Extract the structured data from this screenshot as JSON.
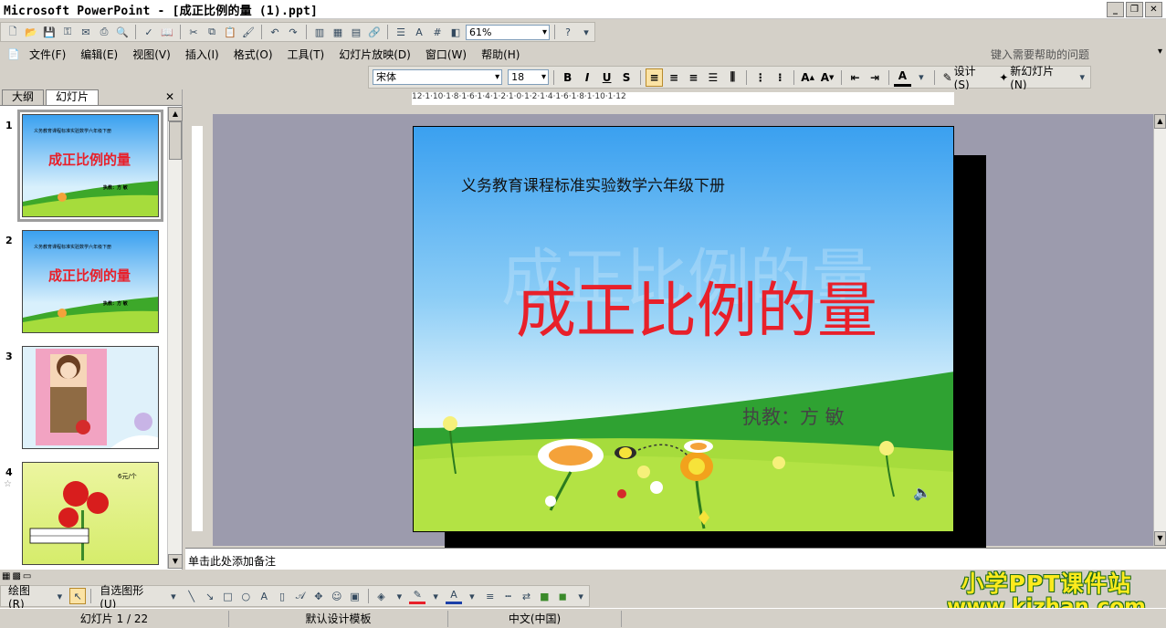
{
  "window": {
    "title": "Microsoft PowerPoint - [成正比例的量 (1).ppt]"
  },
  "toolbar": {
    "zoom": "61%"
  },
  "menu": {
    "items": [
      "文件(F)",
      "编辑(E)",
      "视图(V)",
      "插入(I)",
      "格式(O)",
      "工具(T)",
      "幻灯片放映(D)",
      "窗口(W)",
      "帮助(H)"
    ],
    "help_placeholder": "键入需要帮助的问题"
  },
  "format_toolbar": {
    "font": "宋体",
    "size": "18",
    "design_label": "设计(S)",
    "new_slide_label": "新幻灯片(N)"
  },
  "left_pane": {
    "tabs": [
      "大纲",
      "幻灯片"
    ],
    "slide_numbers": [
      "1",
      "2",
      "3",
      "4"
    ],
    "thumb_title": "成正比例的量",
    "thumb_small_title": "义务教育课程标准实验数学六年级下册",
    "thumb_author": "执教：方 敏",
    "thumb4_label": "6元/个"
  },
  "slide": {
    "subtitle": "义务教育课程标准实验数学六年级下册",
    "title": "成正比例的量",
    "author": "执教：方  敏"
  },
  "ruler": {
    "horizontal": "12·1·10·1·8·1·6·1·4·1·2·1·0·1·2·1·4·1·6·1·8·1·10·1·12"
  },
  "notes": {
    "placeholder": "单击此处添加备注"
  },
  "draw_toolbar": {
    "draw_label": "绘图(R)",
    "autoshapes_label": "自选图形(U)"
  },
  "status": {
    "slide_info": "幻灯片 1 / 22",
    "template": "默认设计模板",
    "language": "中文(中国)"
  },
  "watermark": {
    "line1": "小学PPT课件站",
    "line2": "www.kjzhan.com"
  },
  "colors": {
    "title_red": "#e8202a",
    "sky_top": "#3aa0f0",
    "grass": "#3da82a"
  }
}
